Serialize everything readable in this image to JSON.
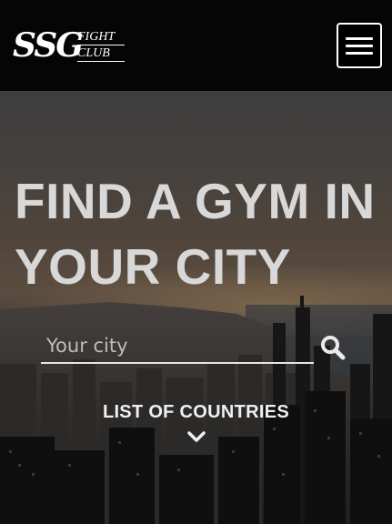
{
  "header": {
    "logo_main": "SSG",
    "logo_line1": "FIGHT",
    "logo_line2": "CLUB",
    "menu_icon": "hamburger-menu-icon"
  },
  "hero": {
    "headline": "FIND A GYM IN YOUR CITY",
    "search_placeholder": "Your city",
    "search_icon": "search-icon",
    "countries_link": "LIST OF COUNTRIES",
    "chevron_icon": "chevron-down-icon"
  }
}
